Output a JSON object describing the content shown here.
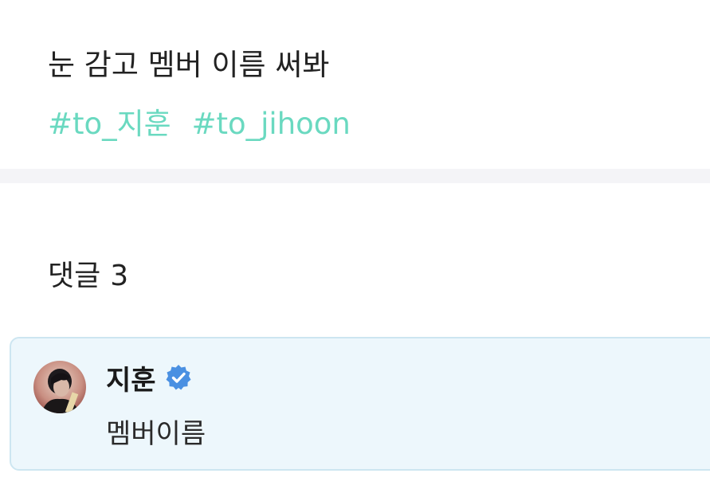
{
  "post": {
    "text": "눈 감고 멤버 이름 써봐",
    "hashtags": [
      "#to_지훈",
      "#to_jihoon"
    ]
  },
  "comments_section": {
    "label": "댓글",
    "count": "3"
  },
  "comments": [
    {
      "author": "지훈",
      "verified": true,
      "text": "멤버이름",
      "avatar_icon": "profile-photo"
    }
  ],
  "colors": {
    "hashtag": "#6ad9c0",
    "comment_bg": "#edf7fc",
    "comment_border": "#cde6f1",
    "verified": "#4a90e2",
    "divider": "#f4f4f7"
  }
}
